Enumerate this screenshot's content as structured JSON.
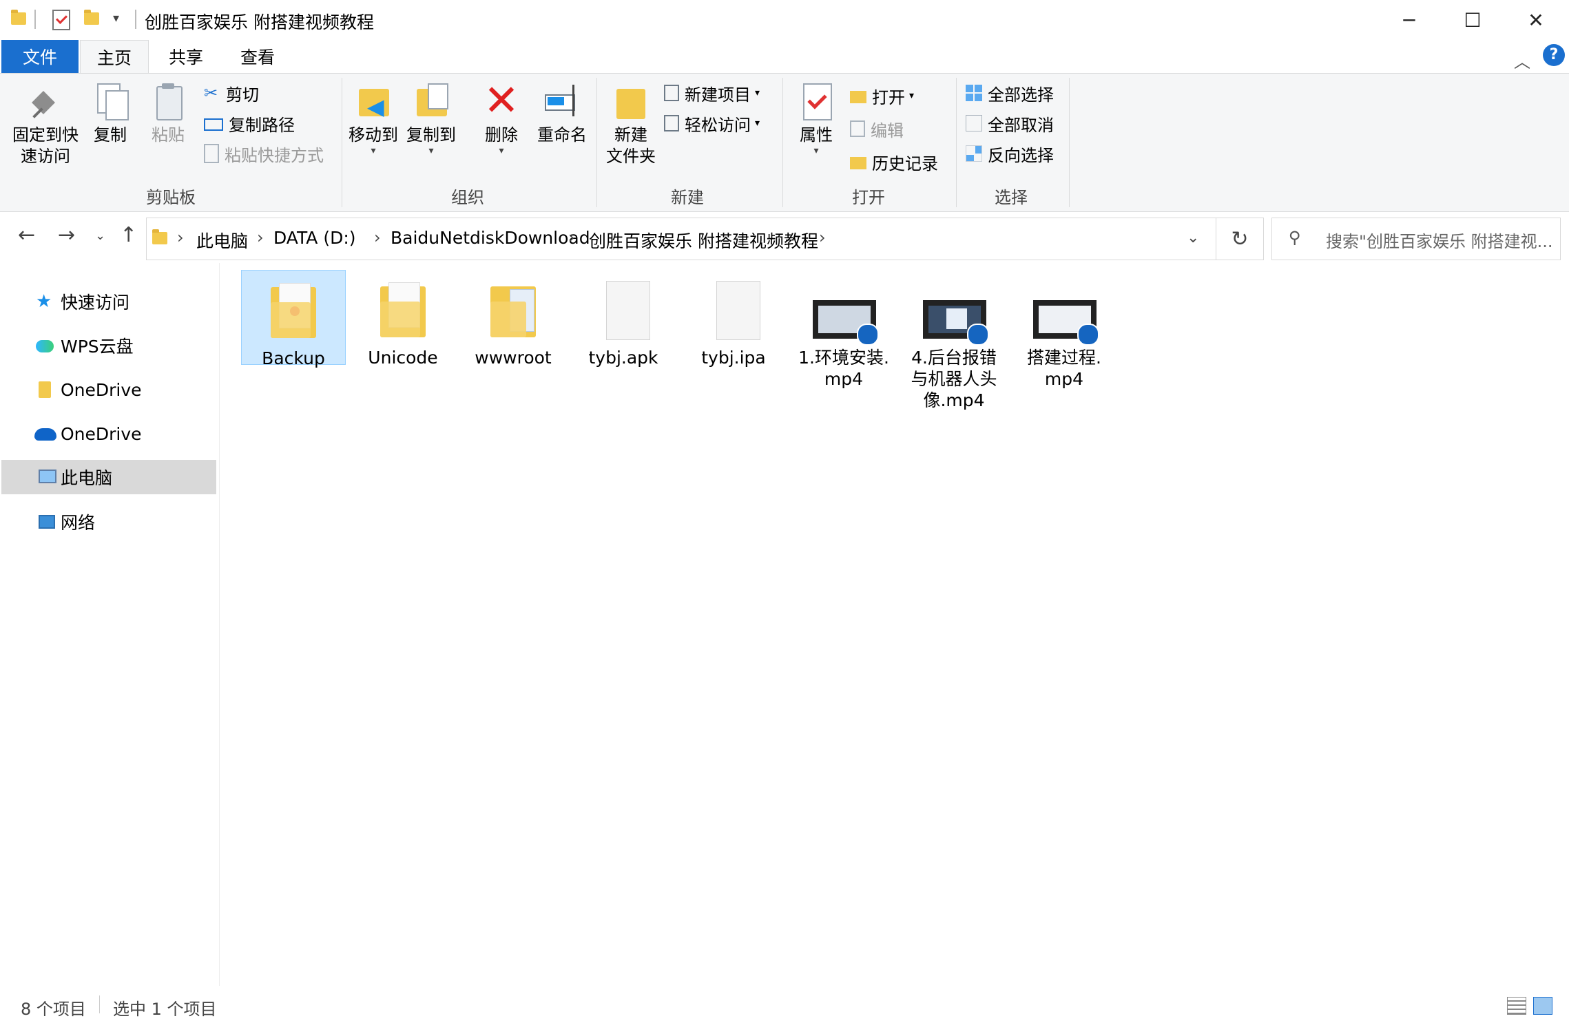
{
  "window": {
    "title": "创胜百家娱乐 附搭建视频教程",
    "minimize_glyph": "─",
    "maximize_glyph": "☐",
    "close_glyph": "✕"
  },
  "tabs": {
    "file": "文件",
    "home": "主页",
    "share": "共享",
    "view": "查看"
  },
  "ribbon": {
    "clipboard": {
      "pin_label_1": "固定到快",
      "pin_label_2": "速访问",
      "copy": "复制",
      "paste": "粘贴",
      "cut": "剪切",
      "copy_path": "复制路径",
      "paste_shortcut": "粘贴快捷方式",
      "group": "剪贴板"
    },
    "organize": {
      "move_to": "移动到",
      "copy_to": "复制到",
      "delete": "删除",
      "rename": "重命名",
      "group": "组织"
    },
    "new": {
      "new_folder_1": "新建",
      "new_folder_2": "文件夹",
      "new_item": "新建项目",
      "easy_access": "轻松访问",
      "group": "新建"
    },
    "open": {
      "properties": "属性",
      "open": "打开",
      "edit": "编辑",
      "history": "历史记录",
      "group": "打开"
    },
    "select": {
      "select_all": "全部选择",
      "select_none": "全部取消",
      "invert": "反向选择",
      "group": "选择"
    }
  },
  "address": {
    "crumbs": [
      "此电脑",
      "DATA (D:)",
      "BaiduNetdiskDownload",
      "创胜百家娱乐 附搭建视频教程"
    ],
    "search_placeholder": "搜索\"创胜百家娱乐 附搭建视..."
  },
  "nav_pane": [
    {
      "label": "快速访问",
      "icon": "star-icon"
    },
    {
      "label": "WPS云盘",
      "icon": "cloud-icon"
    },
    {
      "label": "OneDrive",
      "icon": "folder-icon"
    },
    {
      "label": "OneDrive",
      "icon": "onedrive-cloud-icon"
    },
    {
      "label": "此电脑",
      "icon": "computer-icon",
      "selected": true
    },
    {
      "label": "网络",
      "icon": "network-icon"
    }
  ],
  "files": [
    {
      "name": "Backup",
      "type": "folder",
      "selected": true
    },
    {
      "name": "Unicode",
      "type": "folder"
    },
    {
      "name": "wwwroot",
      "type": "folder"
    },
    {
      "name": "tybj.apk",
      "type": "file"
    },
    {
      "name": "tybj.ipa",
      "type": "file"
    },
    {
      "name_lines": [
        "1.环境安装.",
        "mp4"
      ],
      "type": "video"
    },
    {
      "name_lines": [
        "4.后台报错",
        "与机器人头",
        "像.mp4"
      ],
      "type": "video"
    },
    {
      "name_lines": [
        "搭建过程.",
        "mp4"
      ],
      "type": "video"
    }
  ],
  "status": {
    "count": "8 个项目",
    "selection": "选中 1 个项目"
  }
}
